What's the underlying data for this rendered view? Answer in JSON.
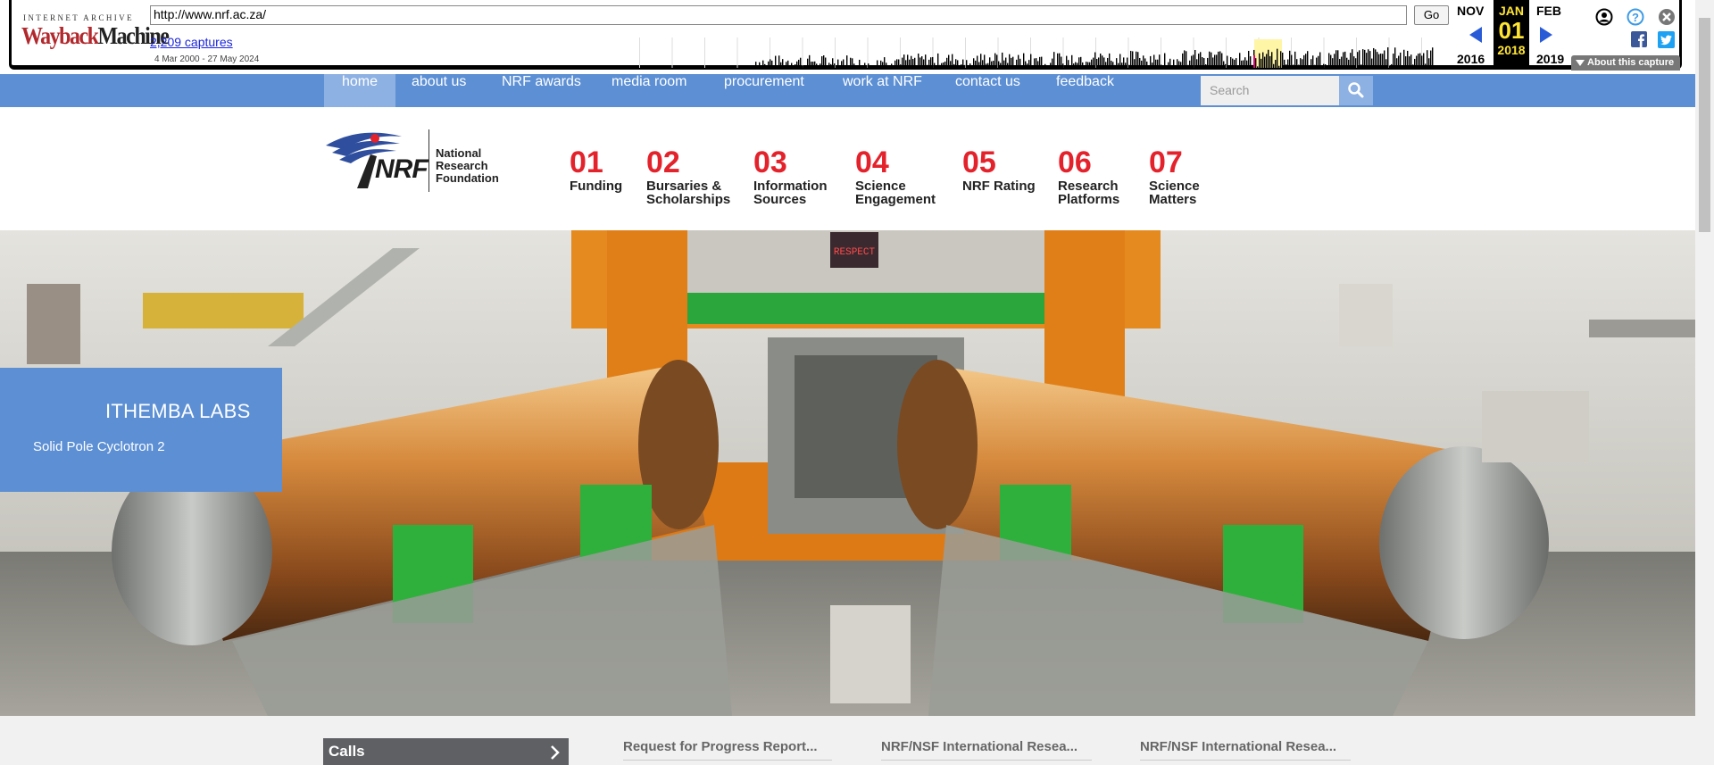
{
  "wayback": {
    "logo_top": "INTERNET ARCHIVE",
    "logo_main_a": "Wayback",
    "logo_main_b": "Machine",
    "url": "http://www.nrf.ac.za/",
    "go_label": "Go",
    "captures": "2,209 captures",
    "range": "4 Mar 2000 - 27 May 2024",
    "prev_month": "NOV",
    "prev_year": "2016",
    "cur_month": "JAN",
    "cur_day": "01",
    "cur_year": "2018",
    "next_month": "FEB",
    "next_year": "2019",
    "about_label": "About this capture",
    "accent": "#ffe533"
  },
  "nav": {
    "items": [
      "home",
      "about us",
      "NRF awards",
      "media room",
      "procurement",
      "work at NRF",
      "contact us",
      "feedback"
    ],
    "search_placeholder": "Search",
    "color": "#5c8fd4"
  },
  "logo": {
    "mark": "NRF",
    "name_line1": "National",
    "name_line2": "Research",
    "name_line3": "Foundation"
  },
  "features": [
    {
      "num": "01",
      "line1": "Funding",
      "line2": ""
    },
    {
      "num": "02",
      "line1": "Bursaries &",
      "line2": "Scholarships"
    },
    {
      "num": "03",
      "line1": "Information",
      "line2": "Sources"
    },
    {
      "num": "04",
      "line1": "Science",
      "line2": "Engagement"
    },
    {
      "num": "05",
      "line1": "NRF Rating",
      "line2": ""
    },
    {
      "num": "06",
      "line1": "Research",
      "line2": "Platforms"
    },
    {
      "num": "07",
      "line1": "Science",
      "line2": "Matters"
    }
  ],
  "hero": {
    "title": "ITHEMBA LABS",
    "subtitle": "Solid Pole Cyclotron 2",
    "display_text": "RESPECT"
  },
  "bottom": {
    "calls_label": "Calls",
    "news": [
      "Request for Progress Report...",
      "NRF/NSF International Resea...",
      "NRF/NSF International Resea..."
    ]
  }
}
